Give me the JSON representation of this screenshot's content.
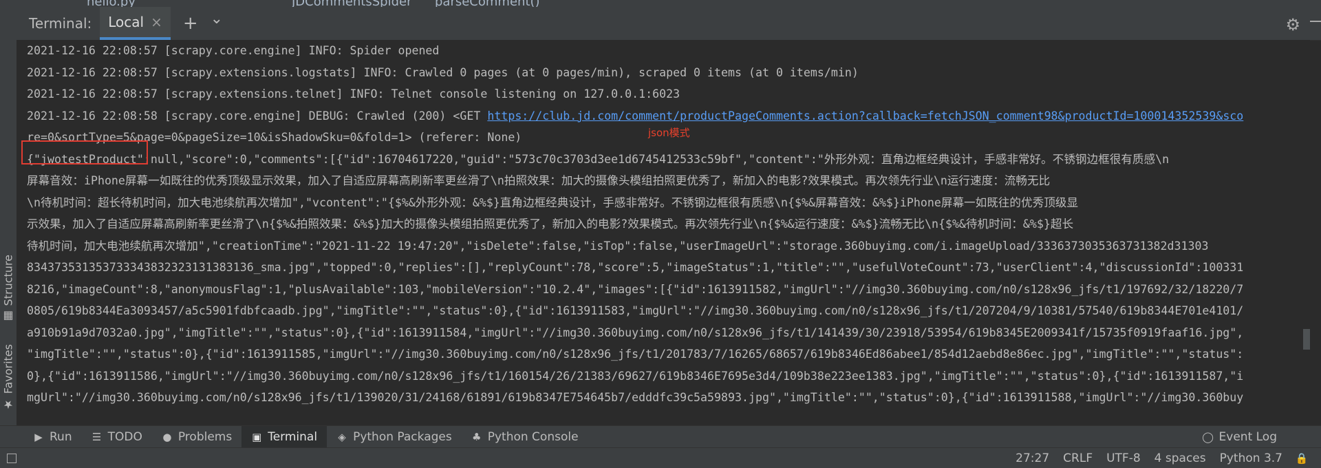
{
  "breadcrumb": {
    "file": "hello.py",
    "class_name": "JDCommentsSpider",
    "method": "parseComment()"
  },
  "left_strip": {
    "structure_label": "Structure",
    "favorites_label": "Favorites"
  },
  "terminal": {
    "title": "Terminal:",
    "tab_label": "Local",
    "tab_close": "×",
    "add_icon": "+",
    "dropdown_icon": "⌄",
    "note": "json模式",
    "lines": [
      "2021-12-16 22:08:57 [scrapy.core.engine] INFO: Spider opened",
      "2021-12-16 22:08:57 [scrapy.extensions.logstats] INFO: Crawled 0 pages (at 0 pages/min), scraped 0 items (at 0 items/min)",
      "2021-12-16 22:08:57 [scrapy.extensions.telnet] INFO: Telnet console listening on 127.0.0.1:6023",
      "",
      "re=0&sortType=5&page=0&pageSize=10&isShadowSku=0&fold=1> (referer: None)",
      "{\"jwotestProduct\":null,\"score\":0,\"comments\":[{\"id\":16704617220,\"guid\":\"573c70c3703d3ee1d6745412533c59bf\",\"content\":\"外形外观：直角边框经典设计，手感非常好。不锈钢边框很有质感\\n",
      "屏幕音效：iPhone屏幕一如既往的优秀顶级显示效果，加入了自适应屏幕高刷新率更丝滑了\\n拍照效果：加大的摄像头模组拍照更优秀了，新加入的电影?效果模式。再次领先行业\\n运行速度：流畅无比",
      "\\n待机时间：超长待机时间，加大电池续航再次增加\",\"vcontent\":\"{$%&外形外观：&%$}直角边框经典设计，手感非常好。不锈钢边框很有质感\\n{$%&屏幕音效：&%$}iPhone屏幕一如既往的优秀顶级显",
      "示效果，加入了自适应屏幕高刷新率更丝滑了\\n{$%&拍照效果：&%$}加大的摄像头模组拍照更优秀了，新加入的电影?效果模式。再次领先行业\\n{$%&运行速度：&%$}流畅无比\\n{$%&待机时间：&%$}超长",
      "待机时间，加大电池续航再次增加\",\"creationTime\":\"2021-11-22 19:47:20\",\"isDelete\":false,\"isTop\":false,\"userImageUrl\":\"storage.360buyimg.com/i.imageUpload/3336373035363731382d31303",
      "834373531353733343832323131383136_sma.jpg\",\"topped\":0,\"replies\":[],\"replyCount\":78,\"score\":5,\"imageStatus\":1,\"title\":\"\",\"usefulVoteCount\":73,\"userClient\":4,\"discussionId\":100331",
      "8216,\"imageCount\":8,\"anonymousFlag\":1,\"plusAvailable\":103,\"mobileVersion\":\"10.2.4\",\"images\":[{\"id\":1613911582,\"imgUrl\":\"//img30.360buyimg.com/n0/s128x96_jfs/t1/197692/32/18220/7",
      "0805/619b8344Ea3093457/a5c5901fdbfcaadb.jpg\",\"imgTitle\":\"\",\"status\":0},{\"id\":1613911583,\"imgUrl\":\"//img30.360buyimg.com/n0/s128x96_jfs/t1/207204/9/10381/57540/619b8344E701e4101/",
      "a910b91a9d7032a0.jpg\",\"imgTitle\":\"\",\"status\":0},{\"id\":1613911584,\"imgUrl\":\"//img30.360buyimg.com/n0/s128x96_jfs/t1/141439/30/23918/53954/619b8345E2009341f/15735f0919faaf16.jpg\",",
      "\"imgTitle\":\"\",\"status\":0},{\"id\":1613911585,\"imgUrl\":\"//img30.360buyimg.com/n0/s128x96_jfs/t1/201783/7/16265/68657/619b8346Ed86abee1/854d12aebd8e86ec.jpg\",\"imgTitle\":\"\",\"status\":",
      "0},{\"id\":1613911586,\"imgUrl\":\"//img30.360buyimg.com/n0/s128x96_jfs/t1/160154/26/21383/69627/619b8346E7695e3d4/109b38e223ee1383.jpg\",\"imgTitle\":\"\",\"status\":0},{\"id\":1613911587,\"i",
      "mgUrl\":\"//img30.360buyimg.com/n0/s128x96_jfs/t1/139020/31/24168/61891/619b8347E754645b7/edddfc39c5a59893.jpg\",\"imgTitle\":\"\",\"status\":0},{\"id\":1613911588,\"imgUrl\":\"//img30.360buy"
    ],
    "debug_prefix": "2021-12-16 22:08:58 [scrapy.core.engine] DEBUG: Crawled (200) <GET ",
    "debug_url": "https://club.jd.com/comment/productPageComments.action?callback=fetchJSON_comment98&productId=100014352539&sco"
  },
  "toolbar_bottom": {
    "run": "Run",
    "todo": "TODO",
    "problems": "Problems",
    "terminal": "Terminal",
    "python_packages": "Python Packages",
    "python_console": "Python Console",
    "event_log": "Event Log"
  },
  "status_bar": {
    "position": "27:27",
    "line_sep": "CRLF",
    "encoding": "UTF-8",
    "indent": "4 spaces",
    "interpreter": "Python 3.7"
  }
}
